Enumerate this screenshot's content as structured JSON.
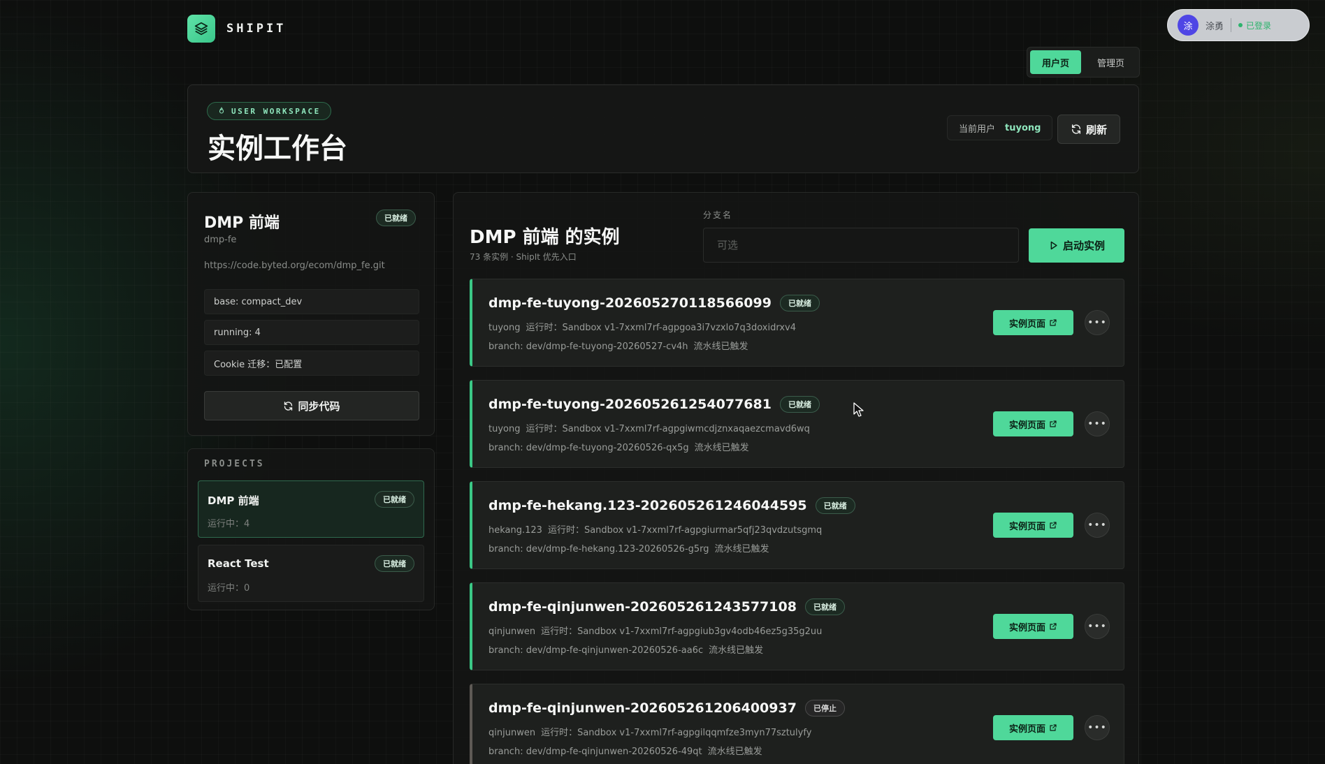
{
  "brand": {
    "name": "SHIPIT"
  },
  "user": {
    "avatar_initial": "涂",
    "name": "涂勇",
    "status": "已登录"
  },
  "view_tabs": {
    "user": "用户页",
    "admin": "管理页",
    "active": "user"
  },
  "header": {
    "badge": "USER WORKSPACE",
    "title": "实例工作台",
    "current_user_label": "当前用户",
    "current_user_value": "tuyong",
    "refresh_label": "刷新"
  },
  "project": {
    "title": "DMP 前端",
    "status": "已就绪",
    "slug": "dmp-fe",
    "repo": "https://code.byted.org/ecom/dmp_fe.git",
    "meta": [
      "base: compact_dev",
      "running: 4",
      "Cookie 迁移：已配置"
    ],
    "sync_label": "同步代码"
  },
  "projects": {
    "label": "PROJECTS",
    "items": [
      {
        "name": "DMP 前端",
        "status": "已就绪",
        "sub": "运行中：4",
        "active": true
      },
      {
        "name": "React Test",
        "status": "已就绪",
        "sub": "运行中：0",
        "active": false
      }
    ]
  },
  "instances": {
    "title": "DMP 前端 的实例",
    "subtitle": "73 条实例 · ShipIt 优先入口",
    "branch_label": "分支名",
    "branch_placeholder": "可选",
    "branch_value": "",
    "launch_label": "启动实例",
    "page_button_label": "实例页面",
    "items": [
      {
        "name": "dmp-fe-tuyong-202605270118566099",
        "status": "已就绪",
        "user": "tuyong",
        "runtime_label": "运行时：",
        "runtime": "Sandbox v1-7xxml7rf-agpgoa3i7vzxlo7q3doxidrxv4",
        "branch": "branch: dev/dmp-fe-tuyong-20260527-cv4h",
        "pipeline": "流水线已触发"
      },
      {
        "name": "dmp-fe-tuyong-202605261254077681",
        "status": "已就绪",
        "user": "tuyong",
        "runtime_label": "运行时：",
        "runtime": "Sandbox v1-7xxml7rf-agpgiwmcdjznxaqaezcmavd6wq",
        "branch": "branch: dev/dmp-fe-tuyong-20260526-qx5g",
        "pipeline": "流水线已触发"
      },
      {
        "name": "dmp-fe-hekang.123-202605261246044595",
        "status": "已就绪",
        "user": "hekang.123",
        "runtime_label": "运行时：",
        "runtime": "Sandbox v1-7xxml7rf-agpgiurmar5qfj23qvdzutsgmq",
        "branch": "branch: dev/dmp-fe-hekang.123-20260526-g5rg",
        "pipeline": "流水线已触发"
      },
      {
        "name": "dmp-fe-qinjunwen-202605261243577108",
        "status": "已就绪",
        "user": "qinjunwen",
        "runtime_label": "运行时：",
        "runtime": "Sandbox v1-7xxml7rf-agpgiub3gv4odb46ez5g35g2uu",
        "branch": "branch: dev/dmp-fe-qinjunwen-20260526-aa6c",
        "pipeline": "流水线已触发"
      },
      {
        "name": "dmp-fe-qinjunwen-202605261206400937",
        "status": "已停止",
        "user": "qinjunwen",
        "runtime_label": "运行时：",
        "runtime": "Sandbox v1-7xxml7rf-agpgilqqmfze3myn77sztulyfy",
        "branch": "branch: dev/dmp-fe-qinjunwen-20260526-49qt",
        "pipeline": "流水线已触发"
      }
    ]
  },
  "colors": {
    "accent": "#4fd89a",
    "ready": "#3bc886",
    "stopped": "#5e5a55"
  },
  "icons": [
    "layers-icon",
    "flame-icon",
    "refresh-icon",
    "play-icon",
    "external-link-icon",
    "more-icon"
  ]
}
